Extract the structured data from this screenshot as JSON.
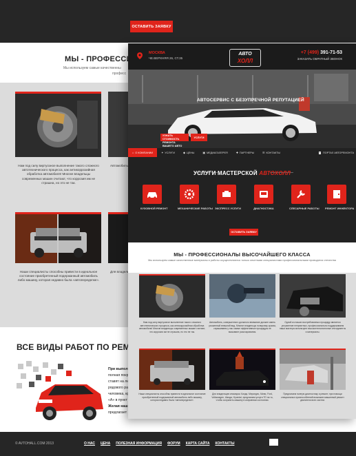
{
  "back": {
    "cta_label": "ОСТАВИТЬ ЗАЯВКУ",
    "pro_title": "МЫ - ПРОФЕССИОНА",
    "pro_sub": "Мы используем самые качественны",
    "pro_sub2": "професс",
    "captions": [
      "Нам под силу виртуозное выполнение такого сложного автотехнического процесса, как антикоррозийная обработка автомобиля! Многие владельцы современных машин считают, что коррозия им не страшна, но это не так.",
      "Автомобиль должен имет владельцы полировка к кузова",
      "Наши специалисты способны привести в идеальное состояние приобретенный подержанный автомобиль либо машину, которая недавно была «автопеределке».",
      "Для владельц Mini, Ford, Volk на то, чтобы с машину, котор гостеприимно"
    ],
    "works_title": "ВСЕ ВИДЫ РАБОТ ПО РЕМОНТУ АВТО",
    "works_lines": [
      "При выполн",
      "полная покр",
      "ставят на ле",
      "рядового ра",
      "человека, кр",
      "«А» в пункт",
      "",
      "Желая наши",
      "предлагает",
      "москвичей, т",
      "безопасност",
      "комфорт!"
    ],
    "footer_copy": "© AVTOHALL.COM 2013",
    "footer_nav": [
      "О НАС",
      "ЦЕНА",
      "ПОЛЕЗНАЯ ИНФОРМАЦИЯ",
      "ФОРУМ",
      "КАРТА САЙТА",
      "КОНТАКТЫ"
    ]
  },
  "front": {
    "city": "МОСКВА",
    "address": "ЧЕ.ВЕРХНЯЯ 26, СТ.35",
    "logo_top": "АВТО",
    "logo_bottom": "ХОЛЛ",
    "phone_prefix": "+7 (499)",
    "phone_number": "391-71-53",
    "callback": "ЗАКАЗАТЬ ОБРАТНЫЙ ЗВОНОК",
    "hero_title": "АВТОСЕРВИС С БЕЗУПРЕЧНОЙ РЕПУТАЦИЕЙ",
    "hero_btn1": "УЗНАТЬ СТОИМОСТЬ РЕМОНТА ВАШЕГО АВТО",
    "hero_btn2": "УСЛУГИ",
    "nav": [
      "О КОМПАНИИ",
      "УСЛУГИ",
      "ЦЕНЫ",
      "МЕДИАГАЛЕРЕЯ",
      "ПАРТНЕРЫ",
      "КОНТАКТЫ"
    ],
    "nav_right": "ПОРТАЛ АВТОРЕМОНТА",
    "services_title_a": "УСЛУГИ МАСТЕРСКОЙ",
    "services_title_b": "АВТОХОЛЛ",
    "services": [
      "КУЗОВНОЙ РЕМОНТ",
      "МЕХАНИЧЕСКИЕ РАБОТЫ",
      "ЭКСПРЕСС УСЛУГИ",
      "ДИАГНОСТИКА",
      "СЛЕСАРНЫЕ РАБОТЫ",
      "РЕМОНТ ИНЖЕКТОРА"
    ],
    "services_cta": "ОСТАВИТЬ ЗАЯВКУ",
    "pro_title": "МЫ - ПРОФЕССИОНАЛЫ ВЫСОЧАЙШЕГО КЛАССА",
    "pro_sub": "Мы используем самые качественные материалы и работы осуществляются только опытными специалистами профессиональными проводятся отечества",
    "captions": [
      "Нам под силу виртуозное выполнение такого сложного автотехнического процесса, как антикоррозийная обработка автомобиля! Многие владельцы современных машин считают, что коррозия им не страшна, но это не так.",
      "Автомобиль, совершенного должного внимание должен иметь ухоженный внешний вид. Многие владельцы полировку кузова, спрашиваем у нас самые эффективные процедуры не вызывают разочарования.",
      "Одной из наших востребованных процедур является устранение неприятных, профессионально поддерживаем наши мастера используют высокотехнологичные инструменты и материалы.",
      "Наши специалисты способны привести в идеальное состояние приобретенный подержанный автомобиль либо машину, которая недавно была «автопеределке».",
      "Для владельцев иномарок Хонда, Мерседес, Мини, Ford, Volkswagen, Шкода, Hyundai, предлагаем услуги ТО на то, чтобы сохранить машину в исправном состоянии.",
      "Предлагаем полную диагностику и ремонт, при помощи специальных приспособлений возможен машинный ремонт двигателя всех систем."
    ]
  }
}
